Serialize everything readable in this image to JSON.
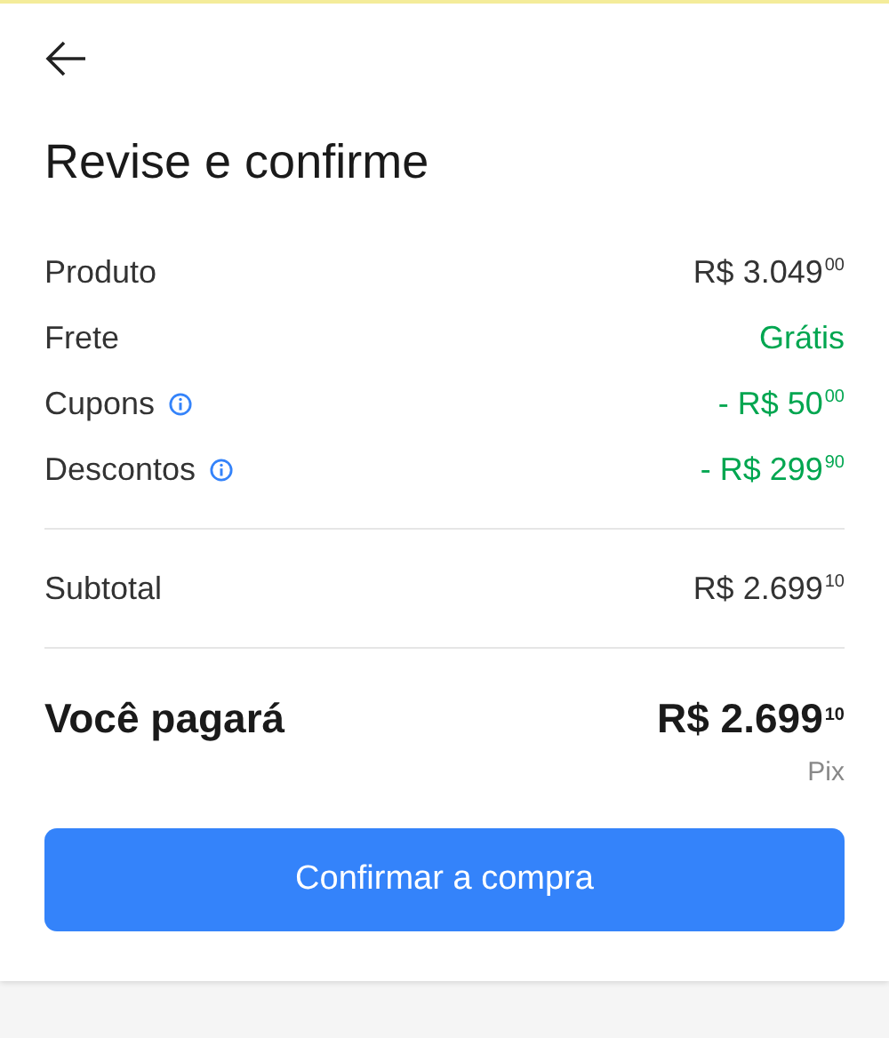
{
  "title": "Revise e confirme",
  "summary": [
    {
      "label": "Produto",
      "info": false,
      "value": "R$ 3.049$^{00}$",
      "color": "#333333"
    },
    {
      "label": "Frete",
      "info": false,
      "value": "Grátis",
      "color": "#00a650"
    },
    {
      "label": "Cupons",
      "info": true,
      "value": "- R$ 50$^{00}$",
      "color": "#00a650"
    },
    {
      "label": "Descontos",
      "info": true,
      "value": "- R$ 299$^{90}$",
      "color": "#00a650"
    }
  ],
  "subtotal": {
    "label": "Subtotal",
    "value": "R$ 2.699$^{10}$"
  },
  "total": {
    "label": "Você pagará",
    "value": "R$ 2.699$^{10}$",
    "method": "Pix"
  },
  "confirm_button": "Confirmar a compra"
}
